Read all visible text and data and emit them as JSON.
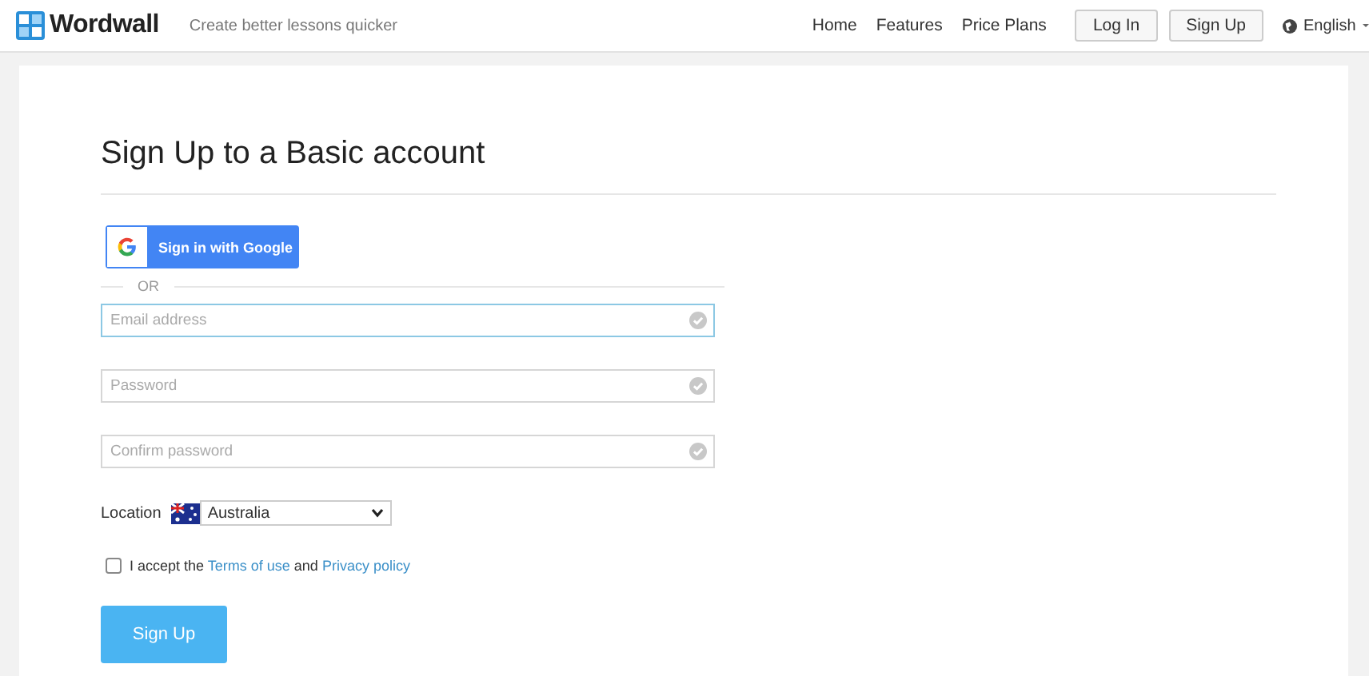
{
  "header": {
    "brand": "Wordwall",
    "tagline": "Create better lessons quicker",
    "nav": [
      {
        "label": "Home",
        "kind": "link"
      },
      {
        "label": "Features",
        "kind": "link"
      },
      {
        "label": "Price Plans",
        "kind": "link"
      },
      {
        "label": "Log In",
        "kind": "button"
      },
      {
        "label": "Sign Up",
        "kind": "button"
      }
    ],
    "language": "English"
  },
  "form": {
    "title": "Sign Up to a Basic account",
    "google_button": "Sign in with Google",
    "separator": "OR",
    "fields": [
      {
        "placeholder": "Email address",
        "focused": true
      },
      {
        "placeholder": "Password",
        "focused": false
      },
      {
        "placeholder": "Confirm password",
        "focused": false
      }
    ],
    "location": {
      "label": "Location",
      "value": "Australia"
    },
    "terms": {
      "checked": false,
      "parts": [
        {
          "kind": "text",
          "text": "I accept the"
        },
        {
          "kind": "link",
          "text": "Terms of use"
        },
        {
          "kind": "text",
          "text": "and"
        },
        {
          "kind": "link",
          "text": "Privacy policy"
        }
      ]
    },
    "submit": "Sign Up"
  }
}
